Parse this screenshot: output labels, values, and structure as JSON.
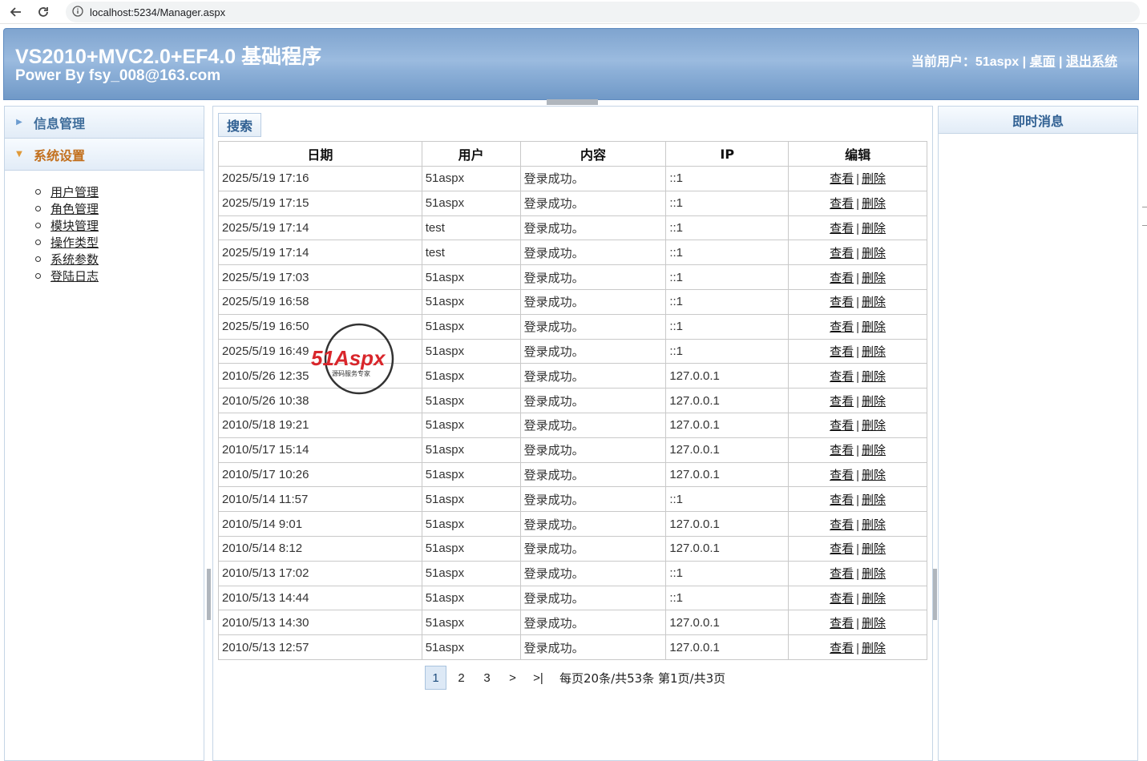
{
  "browser": {
    "url": "localhost:5234/Manager.aspx"
  },
  "header": {
    "title": "VS2010+MVC2.0+EF4.0 基础程序",
    "subtitle": "Power By fsy_008@163.com",
    "current_user_label": "当前用户：",
    "current_user": "51aspx",
    "separator": "|",
    "desktop_link": "桌面",
    "logout_link": "退出系统"
  },
  "sidebar": {
    "sections": [
      {
        "label": "信息管理",
        "state": "collapsed"
      },
      {
        "label": "系统设置",
        "state": "expanded"
      }
    ],
    "items": [
      "用户管理",
      "角色管理",
      "模块管理",
      "操作类型",
      "系统参数",
      "登陆日志"
    ]
  },
  "main": {
    "search_button": "搜索",
    "columns": [
      "日期",
      "用户",
      "内容",
      "IP",
      "编辑"
    ],
    "view_label": "查看",
    "delete_label": "删除",
    "action_separator": "|",
    "rows": [
      {
        "date": "2025/5/19 17:16",
        "user": "51aspx",
        "content": "登录成功。",
        "ip": "::1"
      },
      {
        "date": "2025/5/19 17:15",
        "user": "51aspx",
        "content": "登录成功。",
        "ip": "::1"
      },
      {
        "date": "2025/5/19 17:14",
        "user": "test",
        "content": "登录成功。",
        "ip": "::1"
      },
      {
        "date": "2025/5/19 17:14",
        "user": "test",
        "content": "登录成功。",
        "ip": "::1"
      },
      {
        "date": "2025/5/19 17:03",
        "user": "51aspx",
        "content": "登录成功。",
        "ip": "::1"
      },
      {
        "date": "2025/5/19 16:58",
        "user": "51aspx",
        "content": "登录成功。",
        "ip": "::1"
      },
      {
        "date": "2025/5/19 16:50",
        "user": "51aspx",
        "content": "登录成功。",
        "ip": "::1"
      },
      {
        "date": "2025/5/19 16:49",
        "user": "51aspx",
        "content": "登录成功。",
        "ip": "::1"
      },
      {
        "date": "2010/5/26 12:35",
        "user": "51aspx",
        "content": "登录成功。",
        "ip": "127.0.0.1"
      },
      {
        "date": "2010/5/26 10:38",
        "user": "51aspx",
        "content": "登录成功。",
        "ip": "127.0.0.1"
      },
      {
        "date": "2010/5/18 19:21",
        "user": "51aspx",
        "content": "登录成功。",
        "ip": "127.0.0.1"
      },
      {
        "date": "2010/5/17 15:14",
        "user": "51aspx",
        "content": "登录成功。",
        "ip": "127.0.0.1"
      },
      {
        "date": "2010/5/17 10:26",
        "user": "51aspx",
        "content": "登录成功。",
        "ip": "127.0.0.1"
      },
      {
        "date": "2010/5/14 11:57",
        "user": "51aspx",
        "content": "登录成功。",
        "ip": "::1"
      },
      {
        "date": "2010/5/14 9:01",
        "user": "51aspx",
        "content": "登录成功。",
        "ip": "127.0.0.1"
      },
      {
        "date": "2010/5/14 8:12",
        "user": "51aspx",
        "content": "登录成功。",
        "ip": "127.0.0.1"
      },
      {
        "date": "2010/5/13 17:02",
        "user": "51aspx",
        "content": "登录成功。",
        "ip": "::1"
      },
      {
        "date": "2010/5/13 14:44",
        "user": "51aspx",
        "content": "登录成功。",
        "ip": "::1"
      },
      {
        "date": "2010/5/13 14:30",
        "user": "51aspx",
        "content": "登录成功。",
        "ip": "127.0.0.1"
      },
      {
        "date": "2010/5/13 12:57",
        "user": "51aspx",
        "content": "登录成功。",
        "ip": "127.0.0.1"
      }
    ],
    "pager": {
      "pages": [
        "1",
        "2",
        "3"
      ],
      "current": "1",
      "next": ">",
      "last": ">|",
      "summary": "每页20条/共53条 第1页/共3页"
    }
  },
  "right_panel": {
    "title": "即时消息"
  },
  "watermark": {
    "logo_text": "51Aspx",
    "tagline": "源码服务专家"
  },
  "colors": {
    "header_blue": "#8db0d8",
    "accent_orange": "#c26f1c",
    "panel_title_blue": "#2f5f92",
    "border": "#c5d5e6"
  }
}
